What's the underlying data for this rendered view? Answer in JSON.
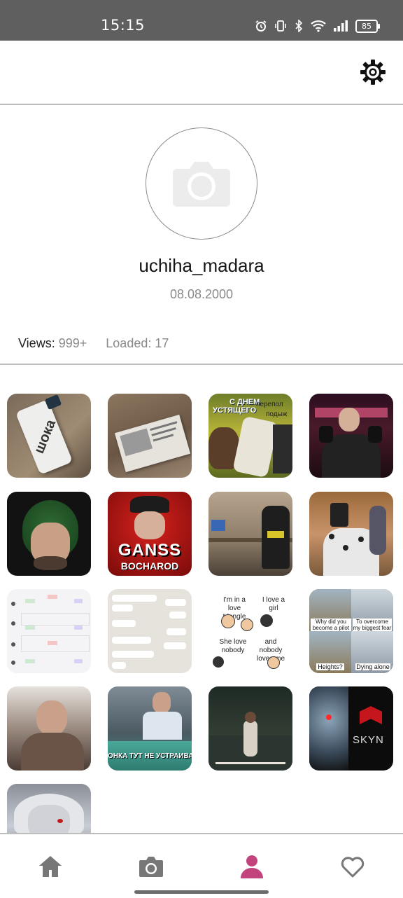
{
  "status_bar": {
    "time": "15:15",
    "battery": "85",
    "icons": [
      "alarm-icon",
      "vibrate-icon",
      "bluetooth-icon",
      "wifi-icon",
      "signal-icon",
      "battery-icon"
    ]
  },
  "app_bar": {
    "icons": [
      "gear-icon"
    ]
  },
  "profile": {
    "avatar_icon": "camera-icon",
    "username": "uchiha_madara",
    "birthdate": "08.08.2000"
  },
  "stats": {
    "views_label": "Views:",
    "views_value": "999+",
    "loaded_label": "Loaded:",
    "loaded_value": "17"
  },
  "gallery": {
    "items": [
      {
        "text": [
          "шока"
        ]
      },
      {
        "text": []
      },
      {
        "text": [
          "С ДНЕМ",
          "УСТЯЩЕГО",
          "перепол",
          "подыж"
        ]
      },
      {
        "text": []
      },
      {
        "text": []
      },
      {
        "text": [
          "GANSS",
          "BOCHAROD"
        ]
      },
      {
        "text": []
      },
      {
        "text": []
      },
      {
        "text": []
      },
      {
        "text": []
      },
      {
        "text": [
          "I'm in a love triangle",
          "I love a girl",
          "She love nobody",
          "and nobody loves me"
        ]
      },
      {
        "text": [
          "Why did you become a pilot",
          "To overcome my biggest fear",
          "Heights?",
          "Dying alone"
        ]
      },
      {
        "text": []
      },
      {
        "text": [
          "ОНКА ТУТ НЕ УСТРАИВА"
        ]
      },
      {
        "text": []
      },
      {
        "text": [
          "SKYN"
        ]
      },
      {
        "text": []
      }
    ]
  },
  "bottom_nav": {
    "items": [
      "home-icon",
      "camera-icon",
      "profile-icon",
      "heart-icon"
    ],
    "active_color": "#c2447d",
    "inactive_color": "#777777"
  }
}
